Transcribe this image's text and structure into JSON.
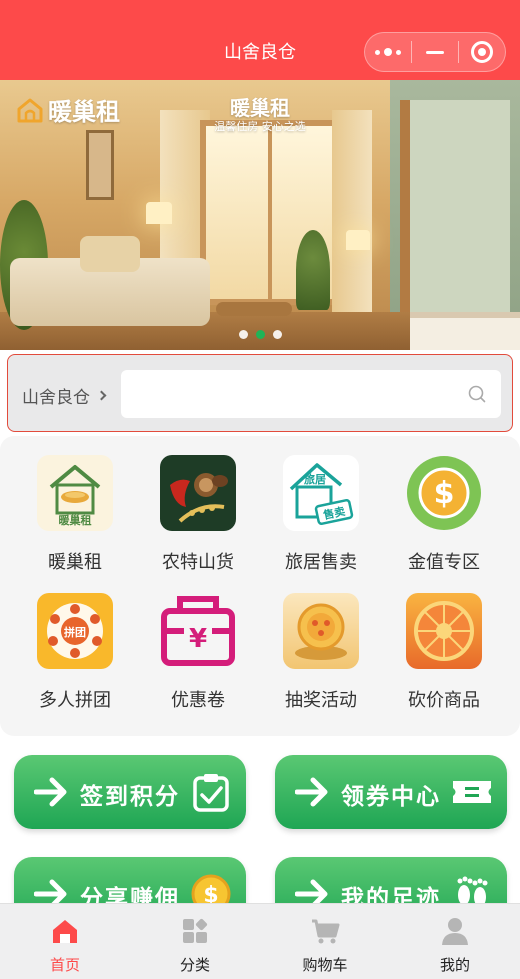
{
  "header": {
    "title": "山舍良仓"
  },
  "banner": {
    "logo_text": "暖巢租",
    "title": "暖巢租",
    "subtitle": "温馨住房 安心之选",
    "slides": 3,
    "active_slide": 2
  },
  "search": {
    "city": "山舍良仓",
    "value": "",
    "placeholder": ""
  },
  "categories": [
    {
      "label": "暖巢租",
      "tile_text": "暖巢租"
    },
    {
      "label": "农特山货"
    },
    {
      "label": "旅居售卖",
      "tile_text_top": "旅居",
      "tile_text_bottom": "售卖"
    },
    {
      "label": "金值专区"
    },
    {
      "label": "多人拼团",
      "tile_text": "拼团"
    },
    {
      "label": "优惠卷"
    },
    {
      "label": "抽奖活动"
    },
    {
      "label": "砍价商品"
    }
  ],
  "actions": [
    {
      "label": "签到积分",
      "icon": "clipboard-check-icon"
    },
    {
      "label": "领券中心",
      "icon": "ticket-icon"
    },
    {
      "label": "分享赚佣",
      "icon": "coin-icon"
    },
    {
      "label": "我的足迹",
      "icon": "footprints-icon"
    }
  ],
  "bottom_nav": [
    {
      "label": "首页",
      "icon": "home-icon",
      "active": true
    },
    {
      "label": "分类",
      "icon": "category-icon",
      "active": false
    },
    {
      "label": "购物车",
      "icon": "cart-icon",
      "active": false
    },
    {
      "label": "我的",
      "icon": "user-icon",
      "active": false
    }
  ],
  "colors": {
    "primary": "#fd4a4a",
    "green": "#1fa654",
    "indicator_active": "#1fb457"
  }
}
